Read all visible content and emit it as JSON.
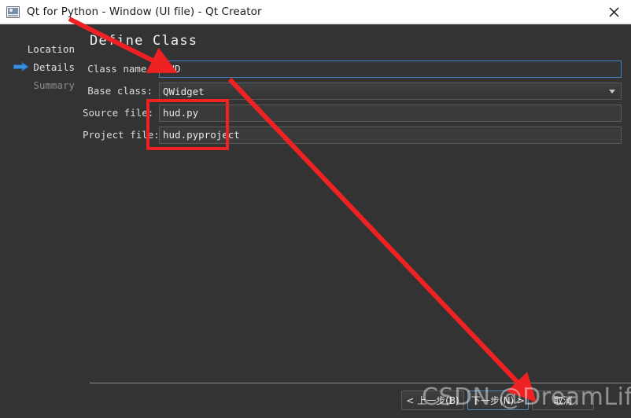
{
  "window": {
    "title": "Qt for Python - Window (UI file) - Qt Creator",
    "app_icon": "qt-designer-icon",
    "close_label": "✕"
  },
  "sidebar": {
    "items": [
      {
        "label": "Location",
        "state": "done"
      },
      {
        "label": "Details",
        "state": "current",
        "marker_icon": "blue-right-arrow-icon"
      },
      {
        "label": "Summary",
        "state": "upcoming"
      }
    ]
  },
  "main": {
    "heading": "Define Class",
    "fields": [
      {
        "label": "Class name:",
        "value": "HUD",
        "type": "text",
        "focused": true
      },
      {
        "label": "Base class:",
        "value": "QWidget",
        "type": "combobox",
        "dropdown_icon": "chevron-down-icon"
      },
      {
        "label": "Source file:",
        "value": "hud.py",
        "type": "text",
        "focused": false
      },
      {
        "label": "Project file:",
        "value": "hud.pyproject",
        "type": "text",
        "focused": false
      }
    ]
  },
  "footer": {
    "buttons": [
      {
        "label": "< 上一步(B)",
        "name": "back-button",
        "primary": false
      },
      {
        "label": "下一步(N) >",
        "name": "next-button",
        "primary": true
      },
      {
        "label": "取消",
        "name": "cancel-button",
        "primary": false
      }
    ]
  },
  "annotations": {
    "arrow_1_target": "class-name-field",
    "arrow_2_target": "next-button",
    "highlight_box_target": "source-and-project-file-fields",
    "accent_color": "#ee2222"
  },
  "watermark": {
    "text": "CSDN @DreamLife."
  },
  "colors": {
    "window_background": "#333333",
    "titlebar_background": "#ffffff",
    "focus_border": "#3f82c4",
    "annotation_red": "#ee2222"
  }
}
